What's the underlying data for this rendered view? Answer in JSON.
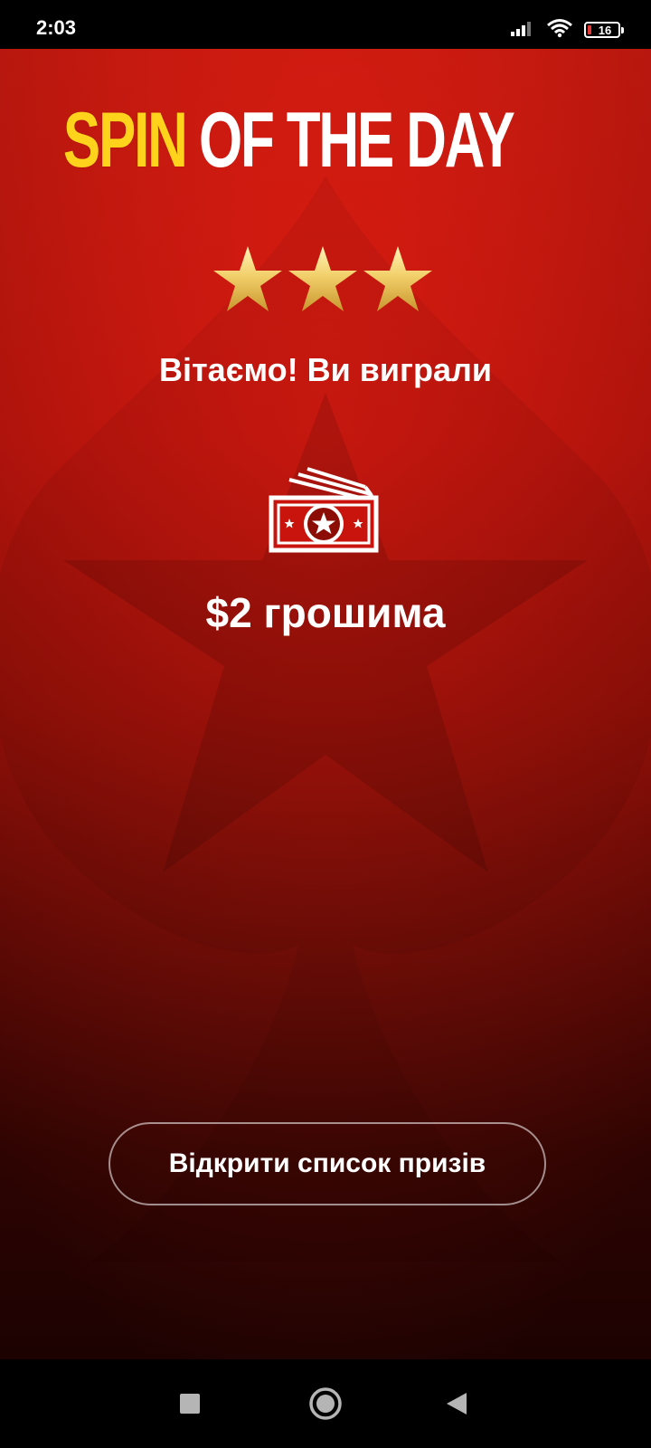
{
  "status_bar": {
    "time": "2:03",
    "battery_level": "16",
    "signal_icon": "cellular-signal-icon",
    "wifi_icon": "wifi-icon",
    "battery_icon": "battery-icon"
  },
  "header": {
    "logo_part1": "SPIN",
    "logo_part2": "OF THE DAY",
    "logo_accent_color": "#ffd21c"
  },
  "result": {
    "stars_count": 3,
    "congrats_text": "Вітаємо! Ви виграли",
    "prize_icon": "cash-prize-icon",
    "prize_text": "$2 грошима"
  },
  "actions": {
    "open_prizes_label": "Відкрити список призів"
  },
  "nav_bar": {
    "recents_icon": "square-recents-icon",
    "home_icon": "circle-home-icon",
    "back_icon": "triangle-back-icon"
  },
  "colors": {
    "background_top": "#dd1b10",
    "background_bottom": "#260302",
    "star_gold": "#f2d06b"
  }
}
